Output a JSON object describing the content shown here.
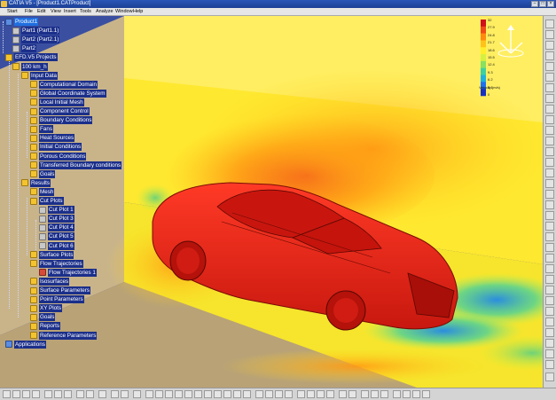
{
  "window": {
    "title": "CATIA V5 - [Product1.CATProduct]"
  },
  "menu": [
    "Start",
    "File",
    "Edit",
    "View",
    "Insert",
    "Tools",
    "Analyze",
    "Window",
    "Help"
  ],
  "tree": [
    {
      "label": "Product1",
      "level": 0,
      "icon": "b",
      "hl": true
    },
    {
      "label": "Part1 (Part1.1)",
      "level": 1,
      "icon": "g"
    },
    {
      "label": "Part2 (Part2.1)",
      "level": 1,
      "icon": "g"
    },
    {
      "label": "Part2",
      "level": 1,
      "icon": "g"
    },
    {
      "label": "EFD.V5 Projects",
      "level": 0,
      "icon": "y"
    },
    {
      "label": "100 km_h",
      "level": 1,
      "icon": "y"
    },
    {
      "label": "Input Data",
      "level": 2,
      "icon": "y"
    },
    {
      "label": "Computational Domain",
      "level": 3,
      "icon": "y"
    },
    {
      "label": "Global Coordinate System",
      "level": 3,
      "icon": "y"
    },
    {
      "label": "Local Initial Mesh",
      "level": 3,
      "icon": "y"
    },
    {
      "label": "Component Control",
      "level": 3,
      "icon": "y"
    },
    {
      "label": "Boundary Conditions",
      "level": 3,
      "icon": "y"
    },
    {
      "label": "Fans",
      "level": 3,
      "icon": "y"
    },
    {
      "label": "Heat Sources",
      "level": 3,
      "icon": "y"
    },
    {
      "label": "Initial Conditions",
      "level": 3,
      "icon": "y"
    },
    {
      "label": "Porous Conditions",
      "level": 3,
      "icon": "y"
    },
    {
      "label": "Transferred Boundary conditions",
      "level": 3,
      "icon": "y"
    },
    {
      "label": "Goals",
      "level": 3,
      "icon": "y"
    },
    {
      "label": "Results",
      "level": 2,
      "icon": "y"
    },
    {
      "label": "Mesh",
      "level": 3,
      "icon": "y"
    },
    {
      "label": "Cut Plots",
      "level": 3,
      "icon": "y"
    },
    {
      "label": "Cut Plot 1",
      "level": 4,
      "icon": "g"
    },
    {
      "label": "Cut Plot 3",
      "level": 4,
      "icon": "g"
    },
    {
      "label": "Cut Plot 4",
      "level": 4,
      "icon": "g"
    },
    {
      "label": "Cut Plot 5",
      "level": 4,
      "icon": "g"
    },
    {
      "label": "Cut Plot 6",
      "level": 4,
      "icon": "g"
    },
    {
      "label": "Surface Plots",
      "level": 3,
      "icon": "y"
    },
    {
      "label": "Flow Trajectories",
      "level": 3,
      "icon": "y"
    },
    {
      "label": "Flow Trajectories 1",
      "level": 4,
      "icon": "r"
    },
    {
      "label": "Isosurfaces",
      "level": 3,
      "icon": "y"
    },
    {
      "label": "Surface Parameters",
      "level": 3,
      "icon": "y"
    },
    {
      "label": "Point Parameters",
      "level": 3,
      "icon": "y"
    },
    {
      "label": "XY Plots",
      "level": 3,
      "icon": "y"
    },
    {
      "label": "Goals",
      "level": 3,
      "icon": "y"
    },
    {
      "label": "Reports",
      "level": 3,
      "icon": "y"
    },
    {
      "label": "Reference Parameters",
      "level": 3,
      "icon": "y"
    },
    {
      "label": "Applications",
      "level": 0,
      "icon": "b"
    }
  ],
  "legend": {
    "title": "Velocity (m/s)",
    "labels": [
      "32",
      "27.9",
      "24.8",
      "21.7",
      "18.6",
      "15.5",
      "12.4",
      "9.3",
      "6.2",
      "3.1",
      "0"
    ],
    "colors": [
      "#d0101a",
      "#f04a18",
      "#ff8a10",
      "#ffc21a",
      "#ffee2a",
      "#d4f040",
      "#8ae060",
      "#40d0a0",
      "#20b0e0",
      "#2070f0",
      "#1830c0"
    ]
  },
  "colors": {
    "car": "#e0221a",
    "field": "#ffe830",
    "background": "#3a4fa0"
  }
}
